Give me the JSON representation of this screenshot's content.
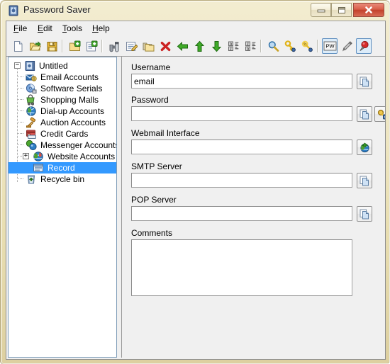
{
  "window": {
    "title": "Password Saver",
    "icon": "app-safe-icon",
    "controls": {
      "minimize": "minimize-button",
      "maximize": "restore-button",
      "close": "close-button",
      "close_glyph": "✕"
    }
  },
  "menubar": {
    "items": [
      {
        "name": "file",
        "accel": "F",
        "rest": "ile"
      },
      {
        "name": "edit",
        "accel": "E",
        "rest": "dit"
      },
      {
        "name": "tools",
        "accel": "T",
        "rest": "ools"
      },
      {
        "name": "help",
        "accel": "H",
        "rest": "elp"
      }
    ]
  },
  "toolbar": {
    "buttons": [
      {
        "name": "new-file-button",
        "icon": "new-document-icon",
        "state": "normal"
      },
      {
        "name": "open-file-button",
        "icon": "open-folder-icon",
        "state": "normal"
      },
      {
        "name": "save-file-button",
        "icon": "save-diskette-icon",
        "state": "normal"
      },
      {
        "name": "new-group-button",
        "icon": "add-folder-icon",
        "state": "normal"
      },
      {
        "name": "new-record-button",
        "icon": "add-record-icon",
        "state": "normal"
      },
      {
        "name": "find-button",
        "icon": "binoculars-icon",
        "state": "normal"
      },
      {
        "name": "edit-record-button",
        "icon": "edit-note-icon",
        "state": "normal"
      },
      {
        "name": "copy-record-button",
        "icon": "copy-folders-icon",
        "state": "normal"
      },
      {
        "name": "delete-record-button",
        "icon": "delete-cross-icon",
        "state": "normal"
      },
      {
        "name": "move-left-button",
        "icon": "arrow-left-icon",
        "state": "normal"
      },
      {
        "name": "move-up-button",
        "icon": "arrow-up-icon",
        "state": "normal"
      },
      {
        "name": "move-down-button",
        "icon": "arrow-down-icon",
        "state": "normal"
      },
      {
        "name": "sort-ascending-button",
        "icon": "sort-az-icon",
        "state": "normal"
      },
      {
        "name": "sort-descending-button",
        "icon": "sort-za-icon",
        "state": "normal"
      },
      {
        "name": "search-button",
        "icon": "magnifier-icon",
        "state": "normal"
      },
      {
        "name": "password-key-button",
        "icon": "key-icon",
        "state": "normal"
      },
      {
        "name": "key-settings-button",
        "icon": "key-gear-icon",
        "state": "normal"
      },
      {
        "name": "password-generator-button",
        "icon": "pw-box-icon",
        "state": "pressed",
        "label": "PW"
      },
      {
        "name": "pencil-button",
        "icon": "pencil-icon",
        "state": "normal"
      },
      {
        "name": "always-on-top-button",
        "icon": "red-pin-icon",
        "state": "pressed"
      }
    ]
  },
  "tree": {
    "nodes": [
      {
        "label": "Untitled",
        "depth": 0,
        "icon": "safe-book-icon",
        "expander": "minus",
        "selected": false
      },
      {
        "label": "Email Accounts",
        "depth": 1,
        "icon": "email-accounts-icon",
        "expander": "none",
        "selected": false
      },
      {
        "label": "Software Serials",
        "depth": 1,
        "icon": "software-serials-icon",
        "expander": "none",
        "selected": false
      },
      {
        "label": "Shopping Malls",
        "depth": 1,
        "icon": "shopping-malls-icon",
        "expander": "none",
        "selected": false
      },
      {
        "label": "Dial-up Accounts",
        "depth": 1,
        "icon": "dialup-accounts-icon",
        "expander": "none",
        "selected": false
      },
      {
        "label": "Auction Accounts",
        "depth": 1,
        "icon": "auction-accounts-icon",
        "expander": "none",
        "selected": false
      },
      {
        "label": "Credit Cards",
        "depth": 1,
        "icon": "credit-cards-icon",
        "expander": "none",
        "selected": false
      },
      {
        "label": "Messenger Accounts",
        "depth": 1,
        "icon": "messenger-accounts-icon",
        "expander": "none",
        "selected": false
      },
      {
        "label": "Website Accounts",
        "depth": 1,
        "icon": "website-accounts-icon",
        "expander": "plus",
        "selected": false
      },
      {
        "label": "Record",
        "depth": 2,
        "icon": "record-icon",
        "expander": "none",
        "selected": true
      },
      {
        "label": "Recycle bin",
        "depth": 1,
        "icon": "recycle-bin-icon",
        "expander": "none",
        "selected": false
      }
    ]
  },
  "detail": {
    "fields": [
      {
        "name": "username",
        "label": "Username",
        "value": "email",
        "placeholder": "",
        "type": "text",
        "buttons": [
          {
            "name": "copy-username-button",
            "icon": "copy-icon"
          }
        ]
      },
      {
        "name": "password",
        "label": "Password",
        "value": "",
        "placeholder": "",
        "type": "text",
        "buttons": [
          {
            "name": "copy-password-button",
            "icon": "copy-icon"
          },
          {
            "name": "show-password-button",
            "icon": "key-lock-icon"
          }
        ]
      },
      {
        "name": "webmail-interface",
        "label": "Webmail Interface",
        "value": "",
        "placeholder": "",
        "type": "text",
        "buttons": [
          {
            "name": "open-webmail-button",
            "icon": "globe-link-icon"
          }
        ]
      },
      {
        "name": "smtp-server",
        "label": "SMTP Server",
        "value": "",
        "placeholder": "",
        "type": "text",
        "buttons": [
          {
            "name": "copy-smtp-button",
            "icon": "copy-icon"
          }
        ]
      },
      {
        "name": "pop-server",
        "label": "POP Server",
        "value": "",
        "placeholder": "",
        "type": "text",
        "buttons": [
          {
            "name": "copy-pop-button",
            "icon": "copy-icon"
          }
        ]
      },
      {
        "name": "comments",
        "label": "Comments",
        "value": "",
        "placeholder": "",
        "type": "textarea",
        "buttons": []
      }
    ]
  },
  "colors": {
    "frame": "#e9dfb2",
    "selection": "#3399ff",
    "pane_bg": "#f0f0f0",
    "tree_bg": "#ffffff",
    "close_red": "#c3412c"
  }
}
